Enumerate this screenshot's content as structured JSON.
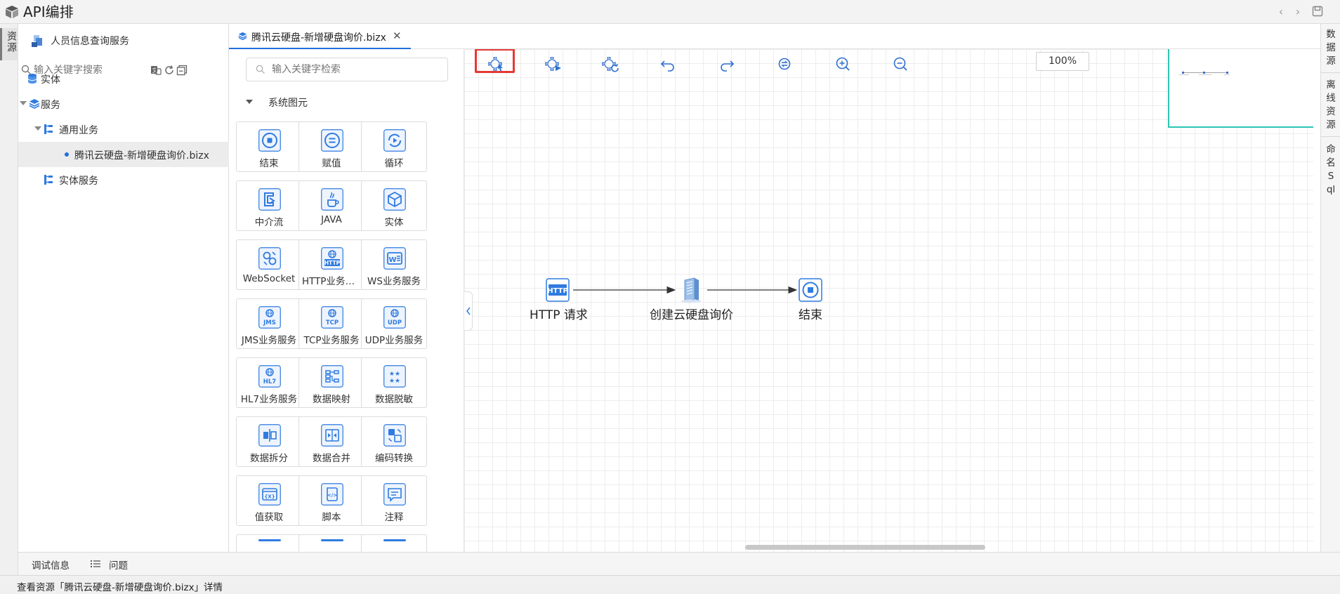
{
  "app": {
    "title": "API编排"
  },
  "left_strip": {
    "resources_tab": "资源"
  },
  "tree": {
    "header": "人员信息查询服务",
    "search_placeholder": "输入关键字搜索",
    "nodes": [
      {
        "label": "实体",
        "icon": "database-icon",
        "level": 0,
        "expanded": false
      },
      {
        "label": "服务",
        "icon": "layers-icon",
        "level": 0,
        "expanded": true
      },
      {
        "label": "通用业务",
        "icon": "flow-tree-icon",
        "level": 1,
        "expanded": true
      },
      {
        "label": "腾讯云硬盘-新增硬盘询价.bizx",
        "icon": "dot-icon",
        "level": 2,
        "selected": true
      },
      {
        "label": "实体服务",
        "icon": "flow-tree-icon",
        "level": 1,
        "expanded": false
      }
    ]
  },
  "editor_tab": {
    "label": "腾讯云硬盘-新增硬盘询价.bizx"
  },
  "palette": {
    "search_placeholder": "输入关键字检索",
    "group_label": "系统图元",
    "items": [
      {
        "label": "结束",
        "icon": "stop-circle-icon"
      },
      {
        "label": "赋值",
        "icon": "equals-circle-icon"
      },
      {
        "label": "循环",
        "icon": "loop-play-icon"
      },
      {
        "label": "中介流",
        "icon": "mediator-flow-icon"
      },
      {
        "label": "JAVA",
        "icon": "java-cup-icon"
      },
      {
        "label": "实体",
        "icon": "cube-icon"
      },
      {
        "label": "WebSocket",
        "icon": "websocket-icon"
      },
      {
        "label": "HTTP业务服务",
        "icon": "http-globe-icon"
      },
      {
        "label": "WS业务服务",
        "icon": "ws-document-icon"
      },
      {
        "label": "JMS业务服务",
        "icon": "jms-globe-icon"
      },
      {
        "label": "TCP业务服务",
        "icon": "tcp-globe-icon"
      },
      {
        "label": "UDP业务服务",
        "icon": "udp-globe-icon"
      },
      {
        "label": "HL7业务服务",
        "icon": "hl7-globe-icon"
      },
      {
        "label": "数据映射",
        "icon": "data-mapping-icon"
      },
      {
        "label": "数据脱敏",
        "icon": "data-masking-icon"
      },
      {
        "label": "数据拆分",
        "icon": "data-split-icon"
      },
      {
        "label": "数据合并",
        "icon": "data-merge-icon"
      },
      {
        "label": "编码转换",
        "icon": "encoding-convert-icon"
      },
      {
        "label": "值获取",
        "icon": "value-fetch-icon"
      },
      {
        "label": "脚本",
        "icon": "script-icon"
      },
      {
        "label": "注释",
        "icon": "comment-icon"
      }
    ]
  },
  "canvas": {
    "toolbar": [
      {
        "name": "auto-layout-icon",
        "highlighted": true
      },
      {
        "name": "run-flow-icon",
        "highlighted": false
      },
      {
        "name": "refresh-flow-icon",
        "highlighted": false
      },
      {
        "name": "undo-icon",
        "highlighted": false
      },
      {
        "name": "redo-icon",
        "highlighted": false
      },
      {
        "name": "fit-view-icon",
        "highlighted": false
      },
      {
        "name": "zoom-in-icon",
        "highlighted": false
      },
      {
        "name": "zoom-out-icon",
        "highlighted": false
      }
    ],
    "zoom_label": "100%",
    "flow_nodes": [
      {
        "label": "HTTP 请求",
        "icon": "http-icon"
      },
      {
        "label": "创建云硬盘询价",
        "icon": "server-icon"
      },
      {
        "label": "结束",
        "icon": "stop-circle-icon"
      }
    ]
  },
  "right_strip": {
    "tabs": [
      "数据源",
      "离线资源",
      "命名Sql"
    ]
  },
  "bottom_tabs": {
    "debug_label": "调试信息",
    "issues_label": "问题"
  },
  "status": {
    "text": "查看资源「腾讯云硬盘-新增硬盘询价.bizx」详情"
  },
  "colors": {
    "accent": "#1f6fe0",
    "highlight": "#e53935",
    "minimap_border": "#2bc4b5"
  }
}
